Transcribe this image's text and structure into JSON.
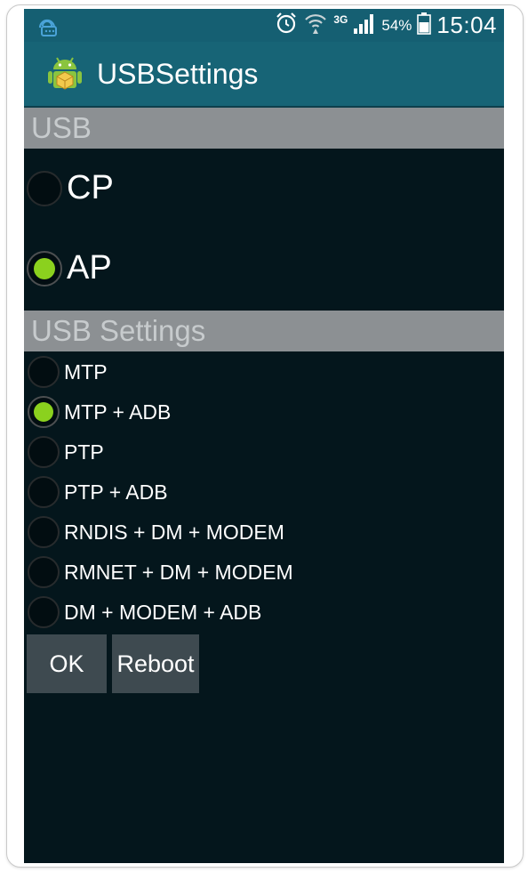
{
  "status_bar": {
    "notification_icon": "network-notification-icon",
    "alarm_icon": "alarm-icon",
    "wifi_icon": "wifi-icon",
    "network_type": "3G",
    "signal_icon": "signal-bars-icon",
    "battery_percent": "54%",
    "battery_icon": "battery-icon",
    "time": "15:04"
  },
  "app_bar": {
    "icon": "android-app-icon",
    "title": "USBSettings"
  },
  "usb_section": {
    "header": "USB",
    "options": [
      {
        "label": "CP",
        "checked": false
      },
      {
        "label": "AP",
        "checked": true
      }
    ]
  },
  "usb_settings_section": {
    "header": "USB Settings",
    "options": [
      {
        "label": "MTP",
        "checked": false
      },
      {
        "label": "MTP + ADB",
        "checked": true
      },
      {
        "label": "PTP",
        "checked": false
      },
      {
        "label": "PTP + ADB",
        "checked": false
      },
      {
        "label": "RNDIS + DM + MODEM",
        "checked": false
      },
      {
        "label": "RMNET + DM + MODEM",
        "checked": false
      },
      {
        "label": "DM + MODEM + ADB",
        "checked": false
      }
    ]
  },
  "buttons": {
    "ok_label": "OK",
    "reboot_label": "Reboot"
  },
  "colors": {
    "status_bar": "#155f72",
    "app_bar": "#176476",
    "background": "#04161c",
    "section_header": "#8c9093",
    "radio_checked": "#8bd11e",
    "button": "#3e4a50"
  }
}
